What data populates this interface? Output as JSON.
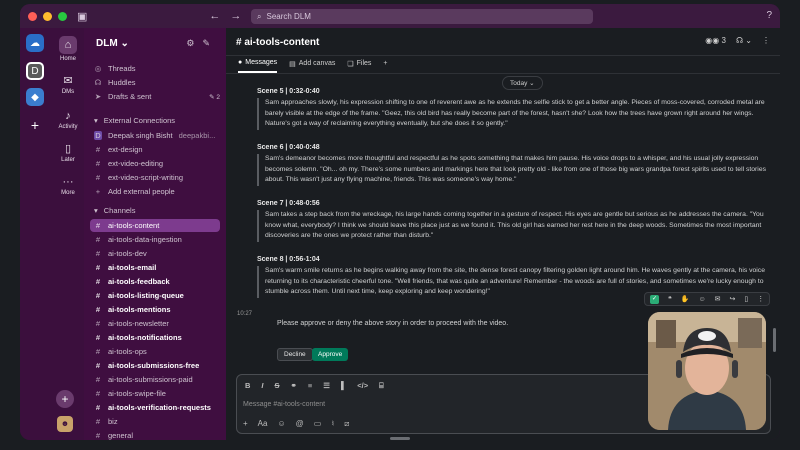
{
  "window": {
    "search_placeholder": "Search DLM"
  },
  "rail": {
    "workspace_letter": "D",
    "items": [
      {
        "label": "Home",
        "icon": "home-icon"
      },
      {
        "label": "DMs",
        "icon": "dm-icon"
      },
      {
        "label": "Activity",
        "icon": "bell-icon"
      },
      {
        "label": "Later",
        "icon": "bookmark-icon"
      },
      {
        "label": "More",
        "icon": "more-icon"
      }
    ],
    "notification_count": "1"
  },
  "sidebar": {
    "workspace": "DLM",
    "top_items": [
      {
        "label": "Threads"
      },
      {
        "label": "Huddles"
      },
      {
        "label": "Drafts & sent",
        "badge": "2"
      }
    ],
    "external_section": "External Connections",
    "external_items": [
      {
        "label": "Deepak singh Bisht",
        "sub": "deepakbi..."
      },
      {
        "label": "ext-design"
      },
      {
        "label": "ext-video-editing"
      },
      {
        "label": "ext-video-script-writing"
      },
      {
        "label": "Add external people"
      }
    ],
    "channels_section": "Channels",
    "channels": [
      {
        "label": "ai-tools-content",
        "active": true
      },
      {
        "label": "ai-tools-data-ingestion"
      },
      {
        "label": "ai-tools-dev"
      },
      {
        "label": "ai-tools-email",
        "bold": true
      },
      {
        "label": "ai-tools-feedback",
        "bold": true
      },
      {
        "label": "ai-tools-listing-queue",
        "bold": true
      },
      {
        "label": "ai-tools-mentions",
        "bold": true
      },
      {
        "label": "ai-tools-newsletter"
      },
      {
        "label": "ai-tools-notifications",
        "bold": true
      },
      {
        "label": "ai-tools-ops"
      },
      {
        "label": "ai-tools-submissions-free",
        "bold": true
      },
      {
        "label": "ai-tools-submissions-paid"
      },
      {
        "label": "ai-tools-swipe-file"
      },
      {
        "label": "ai-tools-verification-requests",
        "bold": true
      },
      {
        "label": "biz"
      },
      {
        "label": "general"
      }
    ]
  },
  "channel": {
    "title": "# ai-tools-content",
    "member_count": "3",
    "tabs": [
      "Messages",
      "Add canvas",
      "Files"
    ],
    "date_divider": "Today"
  },
  "messages": {
    "scenes": [
      {
        "heading": "Scene 5 | 0:32-0:40",
        "text": "Sam approaches slowly, his expression shifting to one of reverent awe as he extends the selfie stick to get a better angle. Pieces of moss-covered, corroded metal are barely visible at the edge of the frame. \"Geez, this old bird has really become part of the forest, hasn't she? Look how the trees have grown right around her wings. Nature's got a way of reclaiming everything eventually, but she does it so gently.\""
      },
      {
        "heading": "Scene 6 | 0:40-0:48",
        "text": "Sam's demeanor becomes more thoughtful and respectful as he spots something that makes him pause. His voice drops to a whisper, and his usual jolly expression becomes solemn. \"Oh... oh my. There's some numbers and markings here that look pretty old - like from one of those big wars grandpa forest spirits used to tell stories about. This wasn't just any flying machine, friends. This was someone's way home.\""
      },
      {
        "heading": "Scene 7 | 0:48-0:56",
        "text": "Sam takes a step back from the wreckage, his large hands coming together in a gesture of respect. His eyes are gentle but serious as he addresses the camera. \"You know what, everybody? I think we should leave this place just as we found it. This old girl has earned her rest here in the deep woods. Sometimes the most important discoveries are the ones we protect rather than disturb.\""
      },
      {
        "heading": "Scene 8 | 0:56-1:04",
        "text": "Sam's warm smile returns as he begins walking away from the site, the dense forest canopy filtering golden light around him. He waves gently at the camera, his voice returning to its characteristic cheerful tone. \"Well friends, that was quite an adventure! Remember - the woods are full of stories, and sometimes we're lucky enough to stumble across them. Until next time, keep exploring and keep wondering!\""
      }
    ],
    "bot_timestamp": "10:27",
    "bot_text": "Please approve or deny the above story in order to proceed with the video.",
    "decline_label": "Decline",
    "approve_label": "Approve"
  },
  "composer": {
    "placeholder": "Message #ai-tools-content"
  },
  "colors": {
    "aubergine": "#3f0e40",
    "active_channel": "#7d3b8e",
    "approve": "#007a5a"
  }
}
